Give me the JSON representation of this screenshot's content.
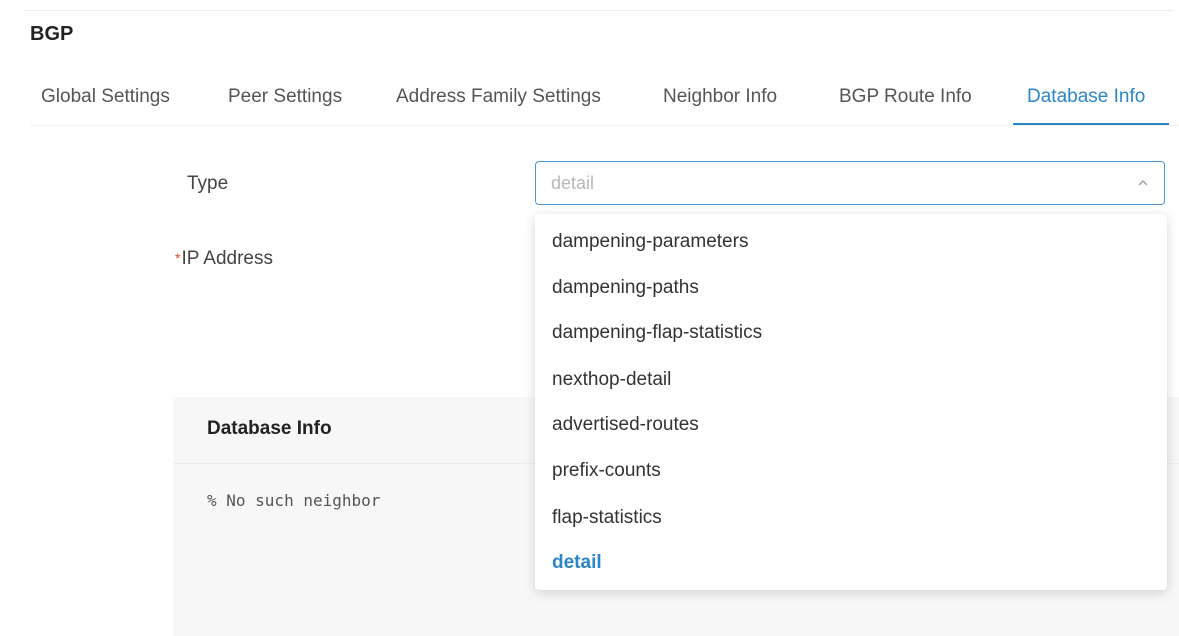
{
  "section": {
    "title": "BGP"
  },
  "tabs": [
    {
      "label": "Global Settings",
      "active": false
    },
    {
      "label": "Peer Settings",
      "active": false
    },
    {
      "label": "Address Family Settings",
      "active": false
    },
    {
      "label": "Neighbor Info",
      "active": false
    },
    {
      "label": "BGP Route Info",
      "active": false
    },
    {
      "label": "Database Info",
      "active": true
    }
  ],
  "form": {
    "type_label": "Type",
    "type_value": "detail",
    "type_open": true,
    "ip_label": "IP Address",
    "ip_required_mark": "*",
    "ip_required": true
  },
  "dropdown": {
    "options": [
      {
        "label": "dampening-parameters",
        "selected": false
      },
      {
        "label": "dampening-paths",
        "selected": false
      },
      {
        "label": "dampening-flap-statistics",
        "selected": false
      },
      {
        "label": "nexthop-detail",
        "selected": false
      },
      {
        "label": "advertised-routes",
        "selected": false
      },
      {
        "label": "prefix-counts",
        "selected": false
      },
      {
        "label": "flap-statistics",
        "selected": false
      },
      {
        "label": "detail",
        "selected": true
      }
    ]
  },
  "info_panel": {
    "title": "Database Info",
    "output": "% No such neighbor"
  },
  "colors": {
    "accent": "#2b86c5",
    "required": "#e0403a",
    "panel_bg": "#f7f7f8",
    "placeholder": "#b8b8b8"
  },
  "icons": {
    "select_toggle": "chevron-up-icon"
  }
}
